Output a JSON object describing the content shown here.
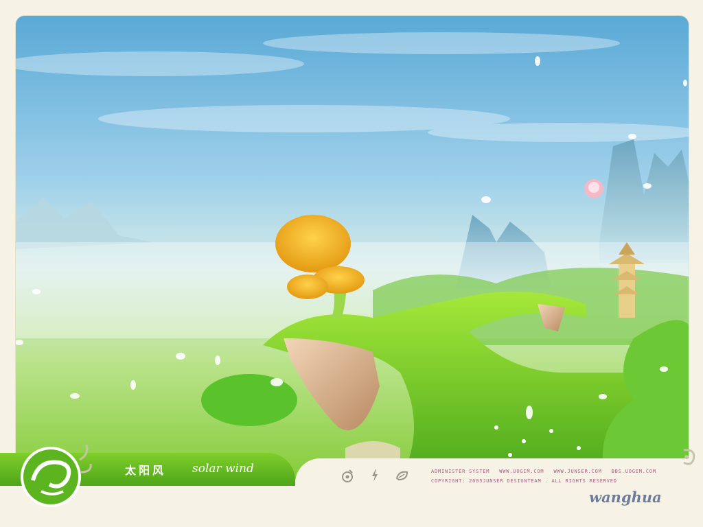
{
  "banner": {
    "title_cn": "太阳风",
    "title_en": "solar wind"
  },
  "footer": {
    "icons": [
      "eye-icon",
      "lightning-icon",
      "leaf-icon"
    ],
    "links": [
      "ADMINISTER SYSTEM",
      "WWW.UOGIM.COM",
      "WWW.JUNSER.COM",
      "BBS.UOGIM.COM"
    ],
    "copyright": "COPYRIGHT: 2005JUNSER DESIGNTEAM . ALL RIGHTS RESERVED",
    "signature": "wanghua"
  },
  "colors": {
    "sky_top": "#5fb0d8",
    "sky_mid": "#b8dff0",
    "grass": "#7ed321",
    "brand_green": "#5cb51e",
    "cream": "#f6f3e6",
    "link_color": "#a0607a",
    "signature_color": "#6c7c9a"
  }
}
